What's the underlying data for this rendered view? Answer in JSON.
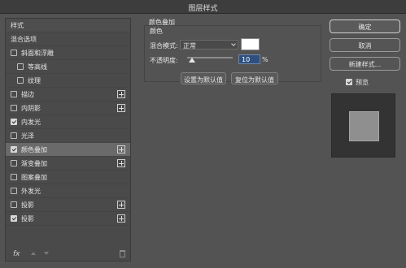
{
  "window": {
    "title": "图层样式"
  },
  "styles_panel": {
    "header": "样式",
    "blend_options": "混合选项",
    "items": [
      {
        "label": "斜面和浮雕",
        "checked": false,
        "has_add": false,
        "indent": false,
        "selected": false
      },
      {
        "label": "等高线",
        "checked": false,
        "has_add": false,
        "indent": true,
        "selected": false
      },
      {
        "label": "纹理",
        "checked": false,
        "has_add": false,
        "indent": true,
        "selected": false
      },
      {
        "label": "描边",
        "checked": false,
        "has_add": true,
        "indent": false,
        "selected": false
      },
      {
        "label": "内阴影",
        "checked": false,
        "has_add": true,
        "indent": false,
        "selected": false
      },
      {
        "label": "内发光",
        "checked": true,
        "has_add": false,
        "indent": false,
        "selected": false
      },
      {
        "label": "光泽",
        "checked": false,
        "has_add": false,
        "indent": false,
        "selected": false
      },
      {
        "label": "颜色叠加",
        "checked": true,
        "has_add": true,
        "indent": false,
        "selected": true
      },
      {
        "label": "渐变叠加",
        "checked": false,
        "has_add": true,
        "indent": false,
        "selected": false
      },
      {
        "label": "图案叠加",
        "checked": false,
        "has_add": false,
        "indent": false,
        "selected": false
      },
      {
        "label": "外发光",
        "checked": false,
        "has_add": false,
        "indent": false,
        "selected": false
      },
      {
        "label": "投影",
        "checked": false,
        "has_add": true,
        "indent": false,
        "selected": false
      },
      {
        "label": "投影",
        "checked": true,
        "has_add": true,
        "indent": false,
        "selected": false
      }
    ],
    "footer": {
      "fx_label": "fx"
    }
  },
  "color_overlay": {
    "group_title": "颜色叠加",
    "sub_title": "颜色",
    "blend_mode_label": "混合模式:",
    "blend_mode_value": "正常",
    "overlay_color": "#ffffff",
    "opacity_label": "不透明度:",
    "opacity_value": "10",
    "opacity_unit": "%",
    "opacity_level": 0.1,
    "set_default": "设置为默认值",
    "reset_default": "复位为默认值"
  },
  "actions": {
    "ok": "确定",
    "cancel": "取消",
    "new_style": "新建样式...",
    "preview_label": "预览",
    "preview_checked": true
  },
  "colors": {
    "background": "#535353",
    "panel": "#4a4a4a",
    "selected_row": "#6a6a6a",
    "input_highlight": "#2f4f7f"
  }
}
